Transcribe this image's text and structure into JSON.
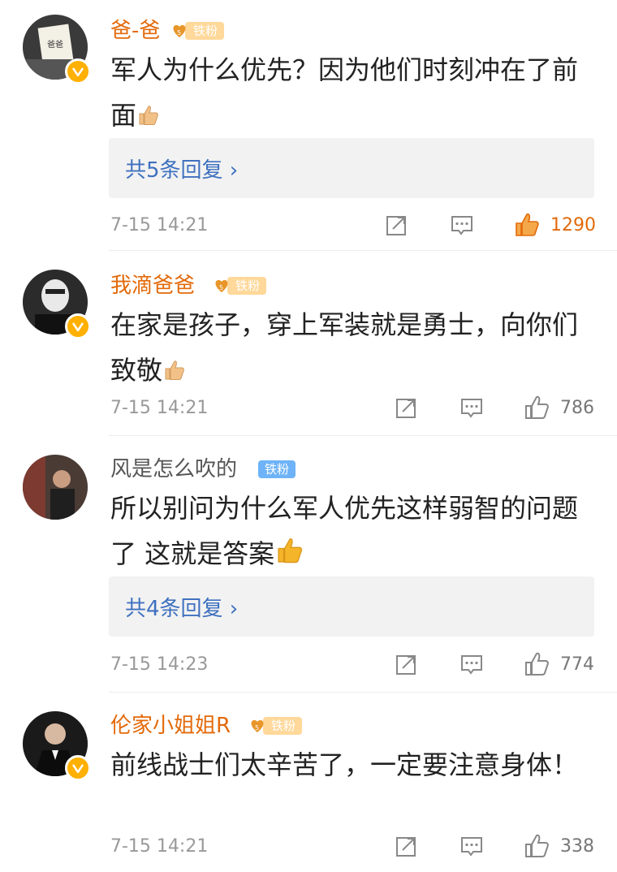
{
  "comments": [
    {
      "username": "爸-爸",
      "fan_badge": "铁粉",
      "text": "军人为什么优先？因为他们时刻冲在了前面",
      "reply_label": "共5条回复 ›",
      "time": "7-15 14:21",
      "likes": "1290",
      "liked": true
    },
    {
      "username": "我滴爸爸",
      "fan_badge": "铁粉",
      "text": "在家是孩子，穿上军装就是勇士，向你们致敬",
      "time": "7-15 14:21",
      "likes": "786",
      "liked": false
    },
    {
      "username": "风是怎么吹的",
      "fan_badge": "铁粉",
      "text": "所以别问为什么军人优先这样弱智的问题了 这就是答案",
      "reply_label": "共4条回复 ›",
      "time": "7-15 14:23",
      "likes": "774",
      "liked": false
    },
    {
      "username": "伦家小姐姐R",
      "fan_badge": "铁粉",
      "text": "前线战士们太辛苦了，一定要注意身体！",
      "time": "7-15 14:21",
      "likes": "338",
      "liked": false
    }
  ],
  "colors": {
    "username": "#e36a0a",
    "reply_link": "#3f71c0",
    "meta": "#999999",
    "liked": "#e36a0a"
  },
  "icons": [
    "verified-badge-icon",
    "fan-heart-icon",
    "thumbs-up-emoji",
    "share-icon",
    "comment-icon",
    "like-icon"
  ]
}
